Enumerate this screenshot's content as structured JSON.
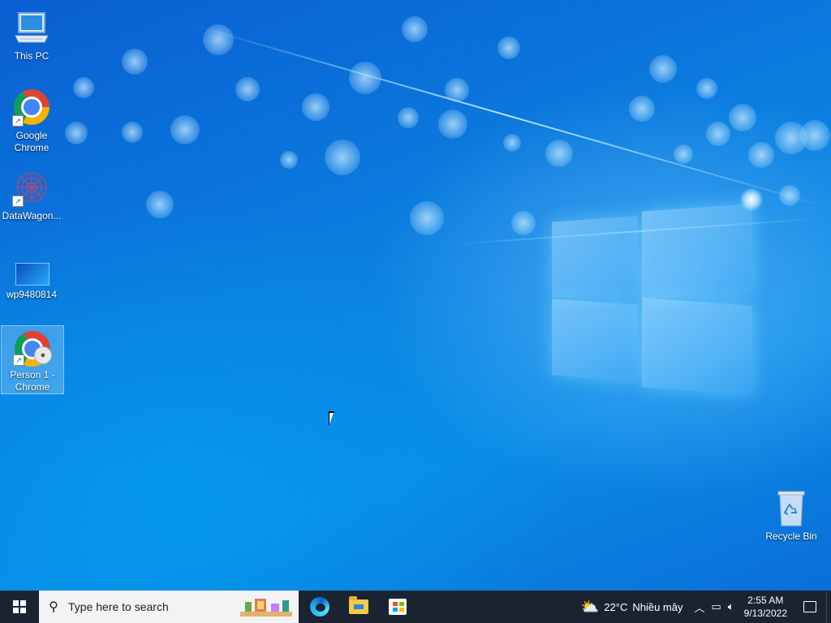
{
  "desktop": {
    "icons": [
      {
        "label": "This PC",
        "icon": "this-pc-icon"
      },
      {
        "label": "Google Chrome",
        "icon": "chrome-icon"
      },
      {
        "label": "DataWagon...",
        "icon": "datawagon-icon"
      },
      {
        "label": "wp9480814",
        "icon": "wallpaper-image-icon"
      },
      {
        "label": "Person 1 - Chrome",
        "icon": "chrome-profile-icon"
      },
      {
        "label": "Recycle Bin",
        "icon": "recycle-bin-icon"
      }
    ]
  },
  "taskbar": {
    "search_placeholder": "Type here to search",
    "weather_temp": "22°C",
    "weather_desc": "Nhiều mây",
    "time": "2:55 AM",
    "date": "9/13/2022"
  },
  "colors": {
    "taskbar_bg": "#1b2331",
    "desktop_accent": "#0b7fe0"
  }
}
